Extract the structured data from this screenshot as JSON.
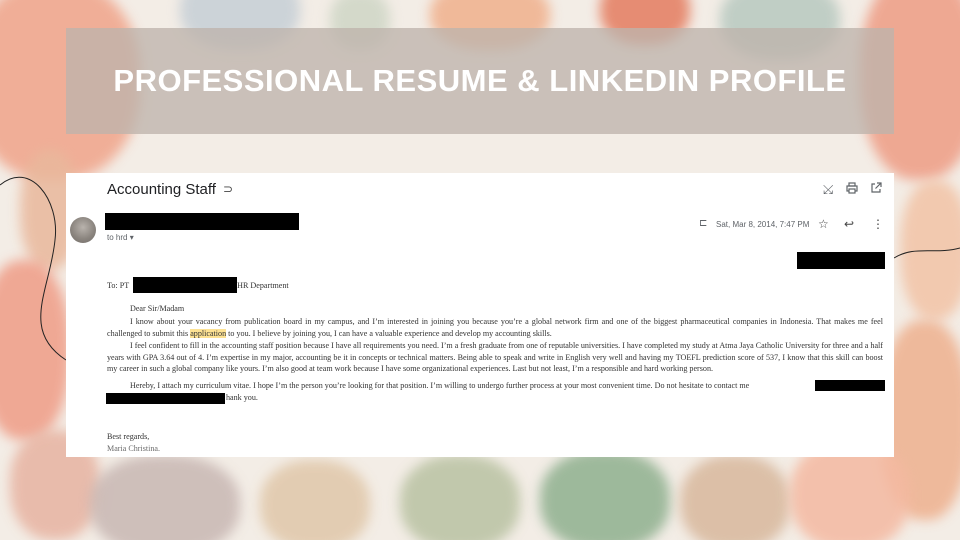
{
  "slide": {
    "title": "PROFESSIONAL RESUME & LINKEDIN PROFILE"
  },
  "email": {
    "subject": "Accounting Staff",
    "recipient_line": "to hrd",
    "date": "Sat, Mar 8, 2014, 7:47 PM",
    "icons": {
      "subject": "label-forward-icon",
      "collapse": "collapse-icon",
      "print": "print-icon",
      "open_new": "open-in-new-window-icon",
      "label": "label-icon",
      "star": "star-icon",
      "reply": "reply-icon",
      "more": "more-vert-icon"
    },
    "body": {
      "to_prefix": "To: PT",
      "to_suffix": "HR Department",
      "greeting": "Dear Sir/Madam",
      "p1_before": "I know about your vacancy from publication board in my campus, and I’m interested in joining you because you’re a global network firm and one of the biggest pharmaceutical companies in Indonesia. That makes me feel challenged to submit this ",
      "p1_highlight": "application",
      "p1_after": " to you. I believe by joining you, I can have a valuable experience and develop my accounting skills.",
      "p2": "I feel confident to fill in the accounting staff position because I have all requirements you need. I’m a fresh graduate from one of reputable universities. I have completed my study at Atma Jaya Catholic University for three and a half years with GPA 3.64 out of 4. I’m expertise in my major, accounting be it in concepts or technical matters. Being able to speak and write in English very well and having my TOEFL prediction score of 537, I know that this skill can boost my career in such a global company like yours. I’m also good at team work because I have some organizational experiences. Last but not least, I’m a responsible and hard working person.",
      "p3_line1": "Hereby, I attach my curriculum vitae. I hope I’m the person you’re looking for that position. I’m willing to undergo further process at your most convenient time. Do not hesitate to contact me",
      "p3_line2_tail": "hank you.",
      "closing": "Best regards,",
      "signature": "Maria Christina."
    }
  },
  "colors": {
    "title_band": "#bdb3ab",
    "highlight": "#fde293",
    "redaction": "#000000"
  }
}
